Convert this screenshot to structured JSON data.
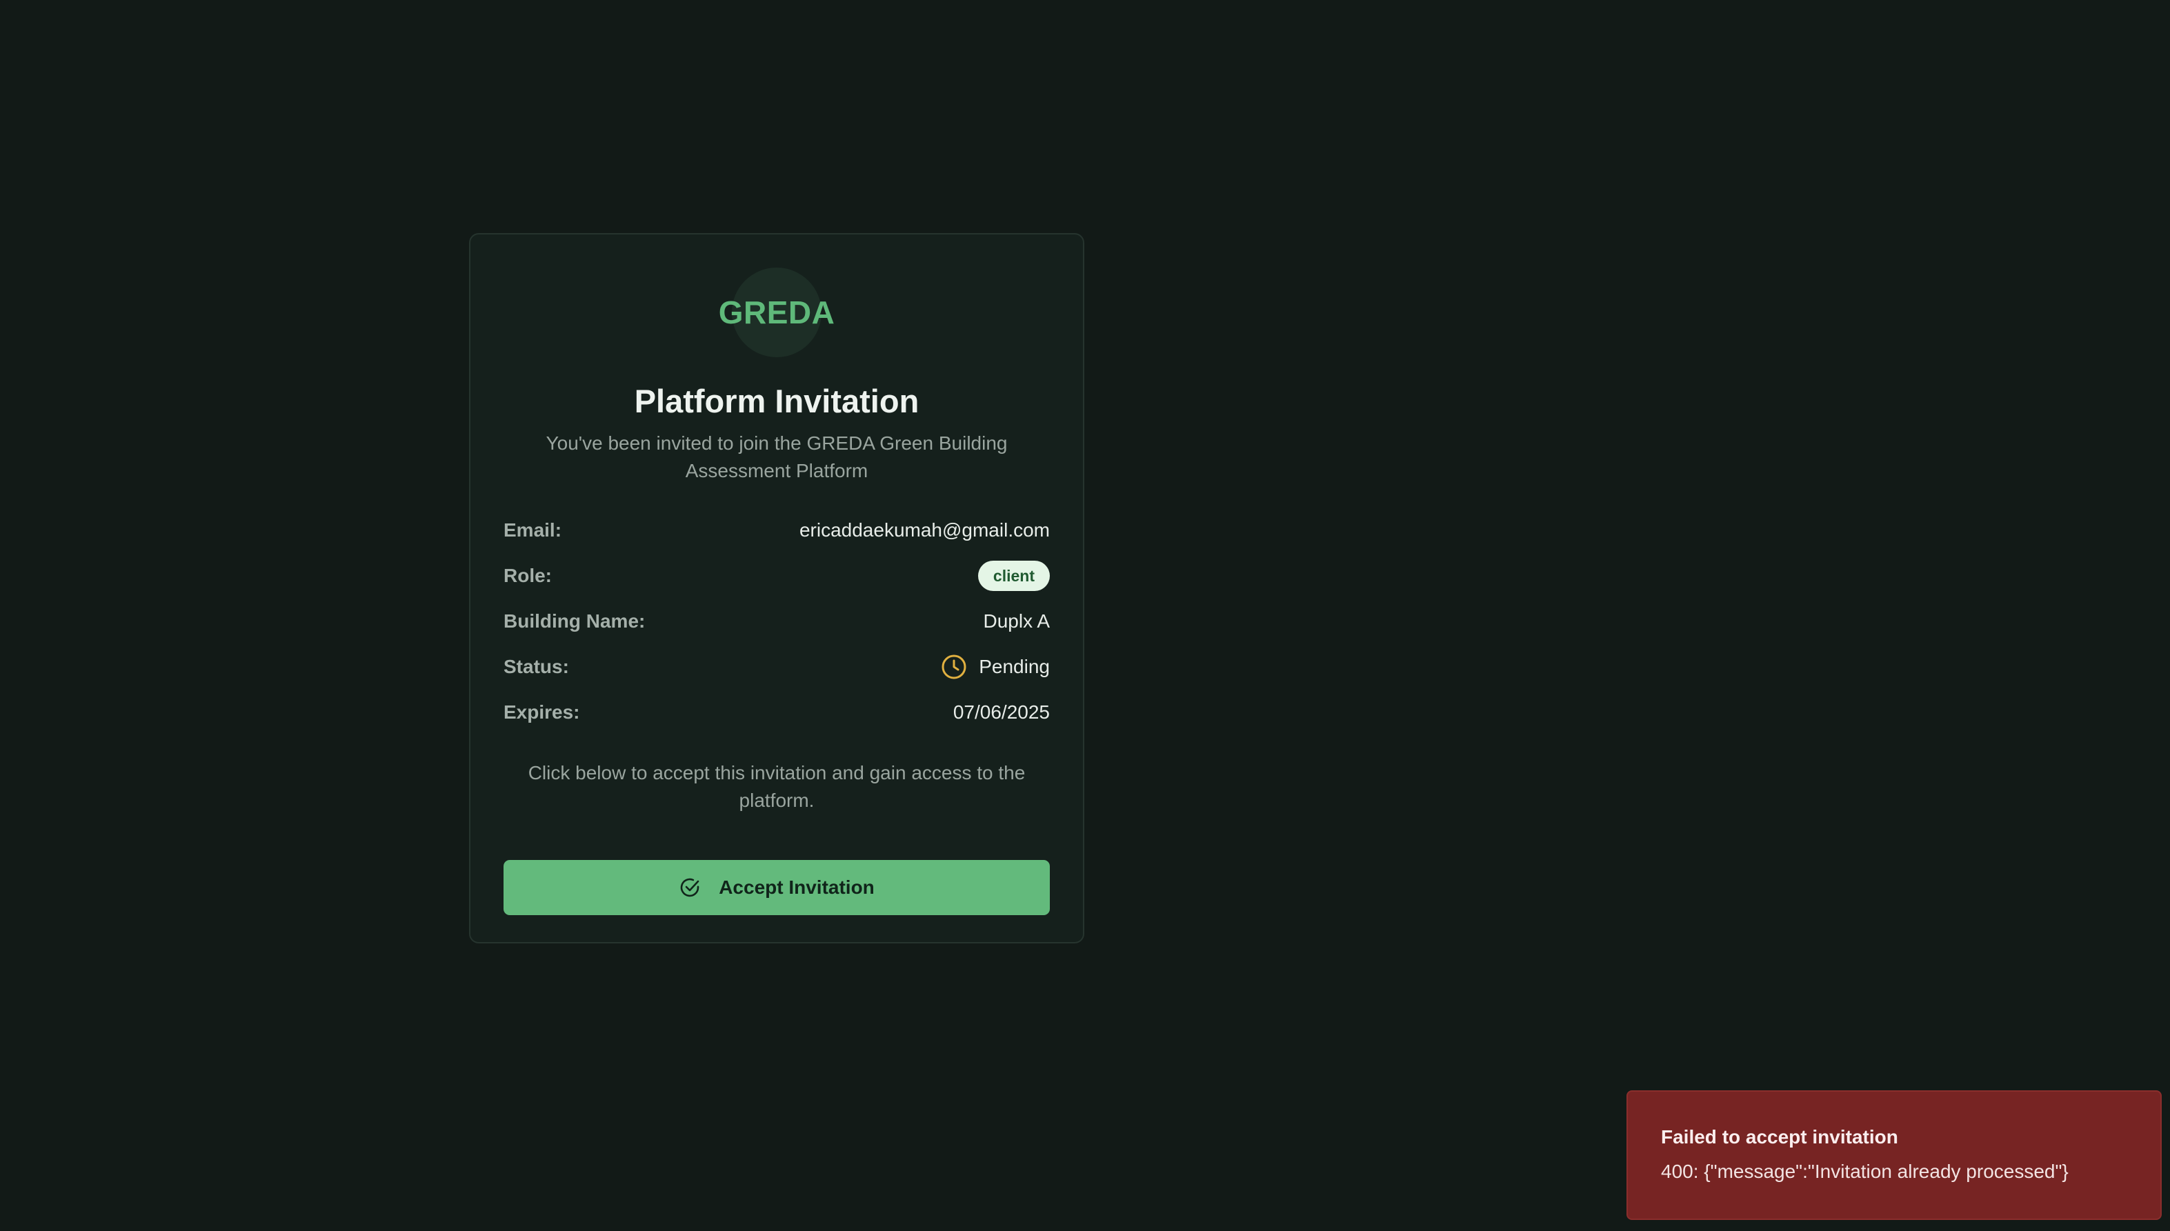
{
  "logo": {
    "text": "GREDA"
  },
  "invitation": {
    "title": "Platform Invitation",
    "subtitle": "You've been invited to join the GREDA Green Building Assessment Platform",
    "fields": {
      "email": {
        "label": "Email:",
        "value": "ericaddaekumah@gmail.com"
      },
      "role": {
        "label": "Role:",
        "value": "client"
      },
      "building": {
        "label": "Building Name:",
        "value": "Duplx A"
      },
      "status": {
        "label": "Status:",
        "value": "Pending",
        "icon": "clock-icon"
      },
      "expires": {
        "label": "Expires:",
        "value": "07/06/2025"
      }
    },
    "note": "Click below to accept this invitation and gain access to the platform.",
    "accept_button": {
      "label": "Accept Invitation",
      "icon": "check-circle-icon"
    }
  },
  "toast": {
    "title": "Failed to accept invitation",
    "message": "400: {\"message\":\"Invitation already processed\"}"
  },
  "colors": {
    "background": "#121a17",
    "card": "#15201c",
    "accent": "#63ba7c",
    "pending": "#e0b040",
    "error": "#772423"
  }
}
